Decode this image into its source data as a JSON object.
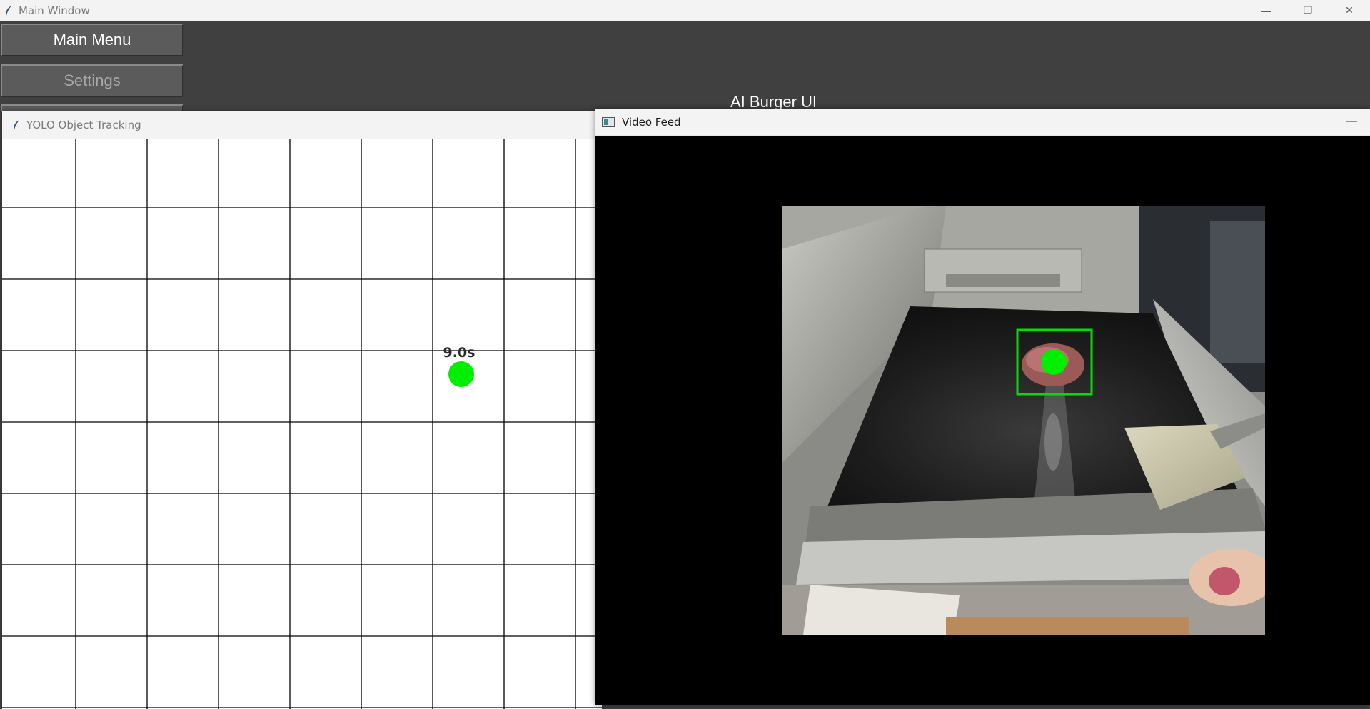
{
  "main_window": {
    "title": "Main Window",
    "controls": {
      "minimize": "—",
      "restore": "❐",
      "close": "✕"
    },
    "buttons": [
      {
        "label": "Main Menu",
        "enabled": true
      },
      {
        "label": "Settings",
        "enabled": false
      }
    ],
    "heading": "AI Burger UI"
  },
  "yolo_window": {
    "title": "YOLO Object Tracking",
    "grid": {
      "columns": 10,
      "rows": 8
    },
    "tracked_object": {
      "label": "9.0s",
      "color": "#00ee00",
      "col": 6.4,
      "row": 3.2
    }
  },
  "video_window": {
    "title": "Video Feed",
    "minimize": "—",
    "detection": {
      "box_color": "#00e000",
      "dot_color": "#00ee00"
    }
  },
  "colors": {
    "desktop": "#404040",
    "titlebar": "#f3f3f3",
    "button": "#5b5b5b",
    "grid_line": "#000000",
    "video_bg": "#000000"
  }
}
